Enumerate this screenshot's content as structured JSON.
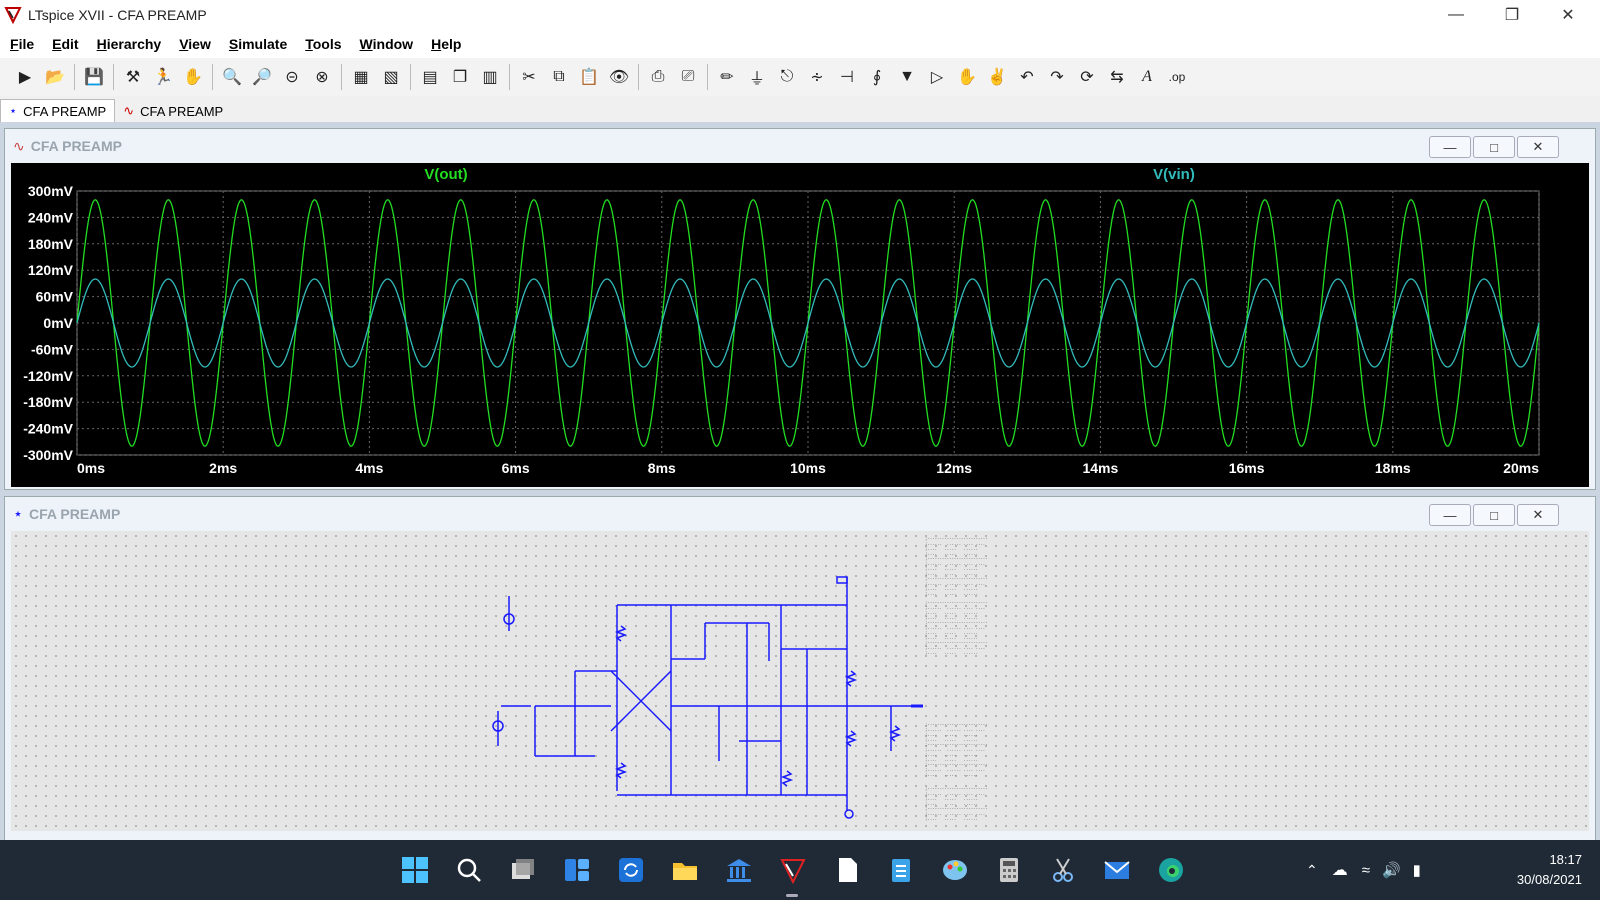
{
  "window": {
    "title": "LTspice XVII - CFA PREAMP"
  },
  "menu": [
    "File",
    "Edit",
    "Hierarchy",
    "View",
    "Simulate",
    "Tools",
    "Window",
    "Help"
  ],
  "tabs": [
    {
      "label": "CFA PREAMP",
      "icon": "schematic-icon"
    },
    {
      "label": "CFA PREAMP",
      "icon": "waveform-icon"
    }
  ],
  "plot_window": {
    "title": "CFA PREAMP"
  },
  "schematic_window": {
    "title": "CFA PREAMP"
  },
  "colors": {
    "vout": "#22dd22",
    "vin": "#33bbbb",
    "plot_bg": "#000000",
    "wire": "#1a1aff"
  },
  "chart_data": {
    "type": "line",
    "x_unit": "ms",
    "xlim": [
      0,
      20
    ],
    "ylim": [
      -300,
      300
    ],
    "xticks": [
      "0ms",
      "2ms",
      "4ms",
      "6ms",
      "8ms",
      "10ms",
      "12ms",
      "14ms",
      "16ms",
      "18ms",
      "20ms"
    ],
    "yticks": [
      "300mV",
      "240mV",
      "180mV",
      "120mV",
      "60mV",
      "0mV",
      "-60mV",
      "-120mV",
      "-180mV",
      "-240mV",
      "-300mV"
    ],
    "grid": true,
    "series": [
      {
        "name": "V(out)",
        "amplitude_mV": 280,
        "frequency_kHz": 1,
        "color": "#22dd22"
      },
      {
        "name": "V(vin)",
        "amplitude_mV": 100,
        "frequency_kHz": 1,
        "color": "#33bbbb"
      }
    ]
  },
  "taskbar": {
    "icons": [
      "start-icon",
      "search-icon",
      "task-view-icon",
      "widgets-icon",
      "sync-icon",
      "file-explorer-icon",
      "library-icon",
      "ltspice-icon",
      "document-icon",
      "notepad-icon",
      "paint-icon",
      "calculator-icon",
      "snipping-tool-icon",
      "mail-icon",
      "edge-icon"
    ],
    "time": "18:17",
    "date": "30/08/2021"
  }
}
